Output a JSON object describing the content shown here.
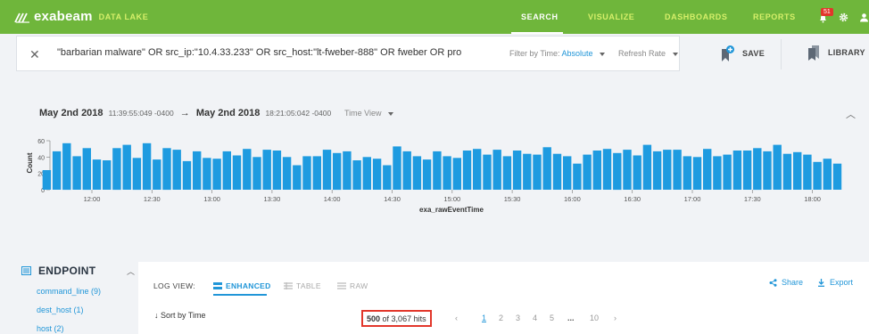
{
  "brand": {
    "name": "exabeam",
    "product": "DATA LAKE"
  },
  "nav": {
    "items": [
      "SEARCH",
      "VISUALIZE",
      "DASHBOARDS",
      "REPORTS"
    ],
    "active": "SEARCH"
  },
  "notifications": {
    "count": "51"
  },
  "search": {
    "query": "\"barbarian malware\" OR src_ip:\"10.4.33.233\" OR src_host:\"lt-fweber-888\" OR fweber OR pro",
    "filter_label": "Filter by Time:",
    "filter_value": "Absolute",
    "refresh_label": "Refresh Rate"
  },
  "actions": {
    "save": "SAVE",
    "library": "LIBRARY"
  },
  "time_range": {
    "from_date": "May 2nd 2018",
    "from_time": "11:39:55:049 -0400",
    "to_date": "May 2nd 2018",
    "to_time": "18:21:05:042 -0400",
    "view_label": "Time View"
  },
  "chart_data": {
    "type": "bar",
    "xlabel": "exa_rawEventTime",
    "ylabel": "Count",
    "ylim": [
      0,
      60
    ],
    "yticks": [
      0,
      20,
      40,
      60
    ],
    "xticks": [
      "12:00",
      "12:30",
      "13:00",
      "13:30",
      "14:00",
      "14:30",
      "15:00",
      "15:30",
      "16:00",
      "16:30",
      "17:00",
      "17:30",
      "18:00"
    ],
    "x_start_minutes": 0,
    "bar_minutes": 5,
    "values": [
      1,
      0,
      0,
      24,
      47,
      57,
      41,
      51,
      37,
      36,
      51,
      55,
      39,
      57,
      37,
      51,
      49,
      35,
      47,
      39,
      38,
      47,
      42,
      50,
      40,
      49,
      48,
      40,
      30,
      41,
      41,
      49,
      45,
      47,
      36,
      40,
      38,
      30,
      53,
      47,
      41,
      37,
      47,
      41,
      39,
      48,
      50,
      43,
      49,
      41,
      48,
      44,
      43,
      52,
      44,
      41,
      32,
      43,
      48,
      50,
      45,
      49,
      42,
      55,
      47,
      49,
      49,
      41,
      40,
      50,
      41,
      43,
      48,
      48,
      51,
      47,
      55,
      44,
      46,
      43,
      34,
      38,
      32,
      0,
      0,
      1
    ]
  },
  "sidebar": {
    "title": "ENDPOINT",
    "items": [
      "command_line (9)",
      "dest_host (1)",
      "host (2)"
    ]
  },
  "log_view": {
    "label": "LOG VIEW:",
    "tabs": [
      "ENHANCED",
      "TABLE",
      "RAW"
    ],
    "share": "Share",
    "export": "Export",
    "sort": "Sort by Time",
    "hits_shown": "500",
    "hits_rest": "of 3,067 hits",
    "pages": [
      "1",
      "2",
      "3",
      "4",
      "5",
      "...",
      "10"
    ]
  }
}
